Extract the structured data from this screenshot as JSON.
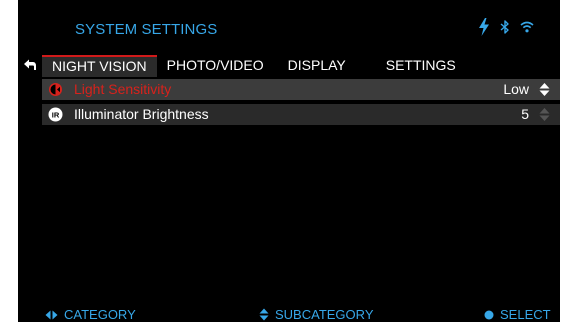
{
  "header": {
    "title": "SYSTEM SETTINGS"
  },
  "status_icons": [
    "lightning-icon",
    "bluetooth-icon",
    "wifi-icon"
  ],
  "tabs": [
    {
      "label": "NIGHT VISION",
      "active": true
    },
    {
      "label": "PHOTO/VIDEO",
      "active": false
    },
    {
      "label": "DISPLAY",
      "active": false
    },
    {
      "label": "SETTINGS",
      "active": false
    }
  ],
  "rows": [
    {
      "label": "Light Sensitivity",
      "value": "Low",
      "icon": "sensitivity-icon",
      "selected": true
    },
    {
      "label": "Illuminator Brightness",
      "value": "5",
      "icon": "ir-icon",
      "selected": false
    }
  ],
  "footer": {
    "category": "CATEGORY",
    "subcategory": "SUBCATEGORY",
    "select": "SELECT"
  },
  "colors": {
    "accent_blue": "#37a7e8",
    "selected_red": "#d7221c",
    "tab_indicator": "#d11a1a",
    "background": "#000000"
  }
}
